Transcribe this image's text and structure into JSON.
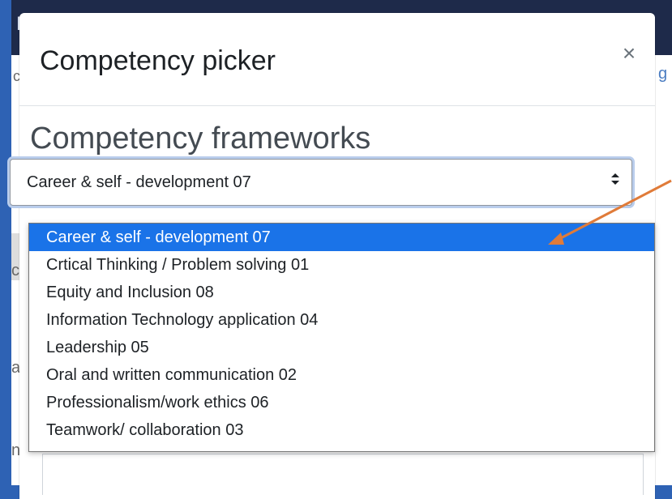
{
  "background": {
    "navbar_fragment": "Li",
    "left_fragments": [
      "c",
      "C",
      "ci",
      "at",
      "nc"
    ],
    "right_fragment": "g"
  },
  "modal": {
    "title": "Competency picker",
    "close_label": "×",
    "section_heading": "Competency frameworks"
  },
  "framework_select": {
    "selected": "Career & self - development 07",
    "arrow": "⬍",
    "options": [
      "Career & self - development 07",
      "Crtical Thinking / Problem solving 01",
      "Equity and Inclusion 08",
      "Information Technology application 04",
      "Leadership 05",
      "Oral and written communication 02",
      "Professionalism/work ethics 06",
      "Teamwork/ collaboration 03"
    ],
    "highlighted_index": 0
  },
  "colors": {
    "outer_background": "#2e62b4",
    "highlight": "#1a73e8",
    "annotation_arrow": "#e07b39"
  }
}
